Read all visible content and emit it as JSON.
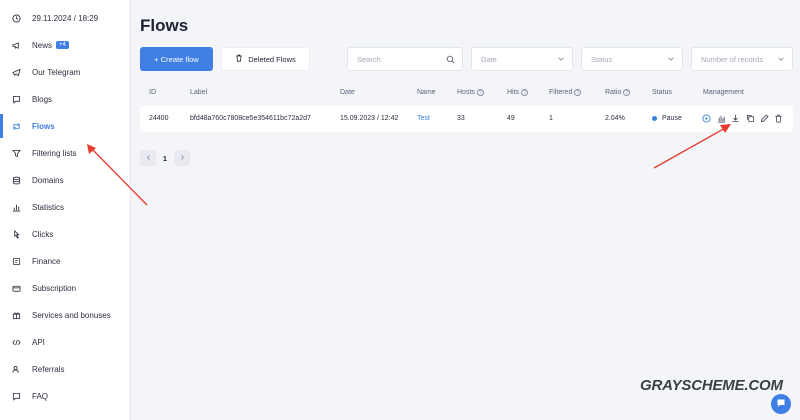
{
  "sidebar": {
    "datetime": "29.11.2024 / 18:29",
    "items": [
      {
        "label": "News",
        "badge": "+4",
        "icon": "megaphone-icon"
      },
      {
        "label": "Our Telegram",
        "icon": "telegram-icon"
      },
      {
        "label": "Blogs",
        "icon": "chat-icon"
      },
      {
        "label": "Flows",
        "icon": "flows-icon",
        "active": true
      },
      {
        "label": "Filtering lists",
        "icon": "filter-icon"
      },
      {
        "label": "Domains",
        "icon": "domains-icon"
      },
      {
        "label": "Statistics",
        "icon": "bar-chart-icon"
      },
      {
        "label": "Clicks",
        "icon": "pointer-icon"
      },
      {
        "label": "Finance",
        "icon": "finance-icon"
      },
      {
        "label": "Subscription",
        "icon": "card-icon"
      },
      {
        "label": "Services and bonuses",
        "icon": "gift-icon"
      },
      {
        "label": "API",
        "icon": "code-icon"
      },
      {
        "label": "Referrals",
        "icon": "users-icon"
      },
      {
        "label": "FAQ",
        "icon": "faq-icon"
      }
    ]
  },
  "page": {
    "title": "Flows",
    "create_button": "+ Create flow",
    "deleted_button": "Deleted Flows",
    "search_placeholder": "Search",
    "date_placeholder": "Date",
    "status_placeholder": "Status",
    "records_placeholder": "Number of records"
  },
  "table": {
    "headers": {
      "id": "ID",
      "label": "Label",
      "date": "Date",
      "name": "Name",
      "hosts": "Hosts",
      "hits": "Hits",
      "filtered": "Filtered",
      "ratio": "Ratio",
      "status": "Status",
      "management": "Management"
    },
    "rows": [
      {
        "id": "24400",
        "label": "bfd48a760c7808ce5e354611bc72a2d7",
        "date": "15.09.2023 / 12:42",
        "name": "Test",
        "hosts": "33",
        "hits": "49",
        "filtered": "1",
        "ratio": "2.04%",
        "status": "Pause"
      }
    ],
    "management_icons": [
      "play-icon",
      "stats-icon",
      "download-icon",
      "copy-icon",
      "edit-icon",
      "delete-icon"
    ]
  },
  "pagination": {
    "current": "1"
  },
  "watermark": "GRAYSCHEME.COM",
  "colors": {
    "accent": "#3f7fe3",
    "annotation": "#e63b2e"
  }
}
